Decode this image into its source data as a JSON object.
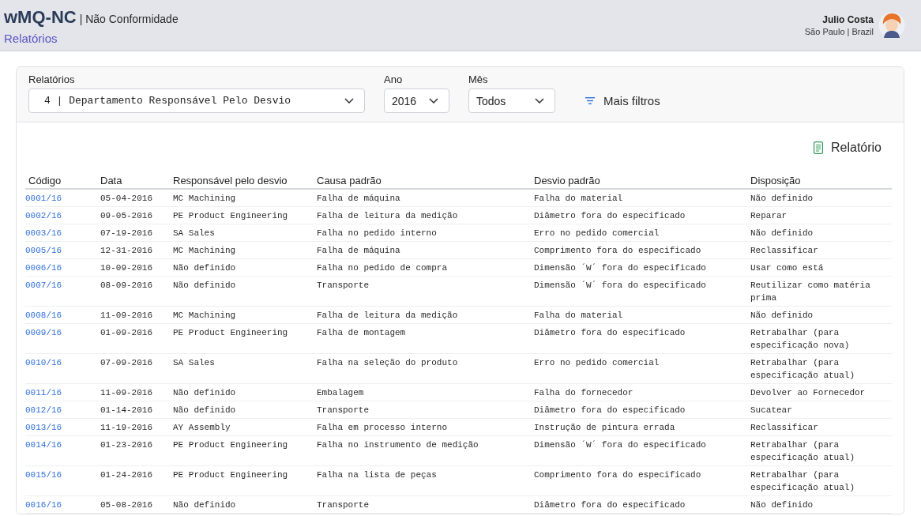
{
  "header": {
    "app_name": "wMQ-NC",
    "module": "| Não Conformidade",
    "page": "Relatórios",
    "user": {
      "name": "Julio Costa",
      "location": "São Paulo | Brazil"
    }
  },
  "filters": [
    {
      "label": "Relatórios",
      "value": "4 | Departamento Responsável Pelo Desvio"
    },
    {
      "label": "Ano",
      "value": "2016"
    },
    {
      "label": "Mês",
      "value": "Todos"
    }
  ],
  "more_filters": "Mais filtros",
  "report_button": "Relatório",
  "table": {
    "columns": [
      "Código",
      "Data",
      "Responsável pelo desvio",
      "Causa padrão",
      "Desvio padrão",
      "Disposição"
    ],
    "rows": [
      [
        "0001/16",
        "05-04-2016",
        "MC Machining",
        "Falha de máquina",
        "Falha do material",
        "Não definido"
      ],
      [
        "0002/16",
        "09-05-2016",
        "PE Product Engineering",
        "Falha de leitura da medição",
        "Diâmetro fora do especificado",
        "Reparar"
      ],
      [
        "0003/16",
        "07-19-2016",
        "SA Sales",
        "Falha no pedido interno",
        "Erro no pedido comercial",
        "Não definido"
      ],
      [
        "0005/16",
        "12-31-2016",
        "MC Machining",
        "Falha de máquina",
        "Comprimento fora do especificado",
        "Reclassificar"
      ],
      [
        "0006/16",
        "10-09-2016",
        "Não definido",
        "Falha no pedido de compra",
        "Dimensão ´W´ fora do especificado",
        "Usar como está"
      ],
      [
        "0007/16",
        "08-09-2016",
        "Não definido",
        "Transporte",
        "Dimensão ´W´ fora do especificado",
        "Reutilizar como matéria prima"
      ],
      [
        "0008/16",
        "11-09-2016",
        "MC Machining",
        "Falha de leitura da medição",
        "Falha do material",
        "Não definido"
      ],
      [
        "0009/16",
        "01-09-2016",
        "PE Product Engineering",
        "Falha de montagem",
        "Diâmetro fora do especificado",
        "Retrabalhar (para especificação nova)"
      ],
      [
        "0010/16",
        "07-09-2016",
        "SA Sales",
        "Falha na seleção do produto",
        "Erro no pedido comercial",
        "Retrabalhar (para especificação atual)"
      ],
      [
        "0011/16",
        "11-09-2016",
        "Não definido",
        "Embalagem",
        "Falha do fornecedor",
        "Devolver ao Fornecedor"
      ],
      [
        "0012/16",
        "01-14-2016",
        "Não definido",
        "Transporte",
        "Diâmetro fora do especificado",
        "Sucatear"
      ],
      [
        "0013/16",
        "11-19-2016",
        "AY Assembly",
        "Falha em processo interno",
        "Instrução de pintura errada",
        "Reclassificar"
      ],
      [
        "0014/16",
        "01-23-2016",
        "PE Product Engineering",
        "Falha no instrumento de medição",
        "Dimensão ´W´ fora do especificado",
        "Retrabalhar (para especificação atual)"
      ],
      [
        "0015/16",
        "01-24-2016",
        "PE Product Engineering",
        "Falha na lista de peças",
        "Comprimento fora do especificado",
        "Retrabalhar (para especificação atual)"
      ],
      [
        "0016/16",
        "05-08-2016",
        "Não definido",
        "Transporte",
        "Diâmetro fora do especificado",
        "Não definido"
      ]
    ]
  }
}
